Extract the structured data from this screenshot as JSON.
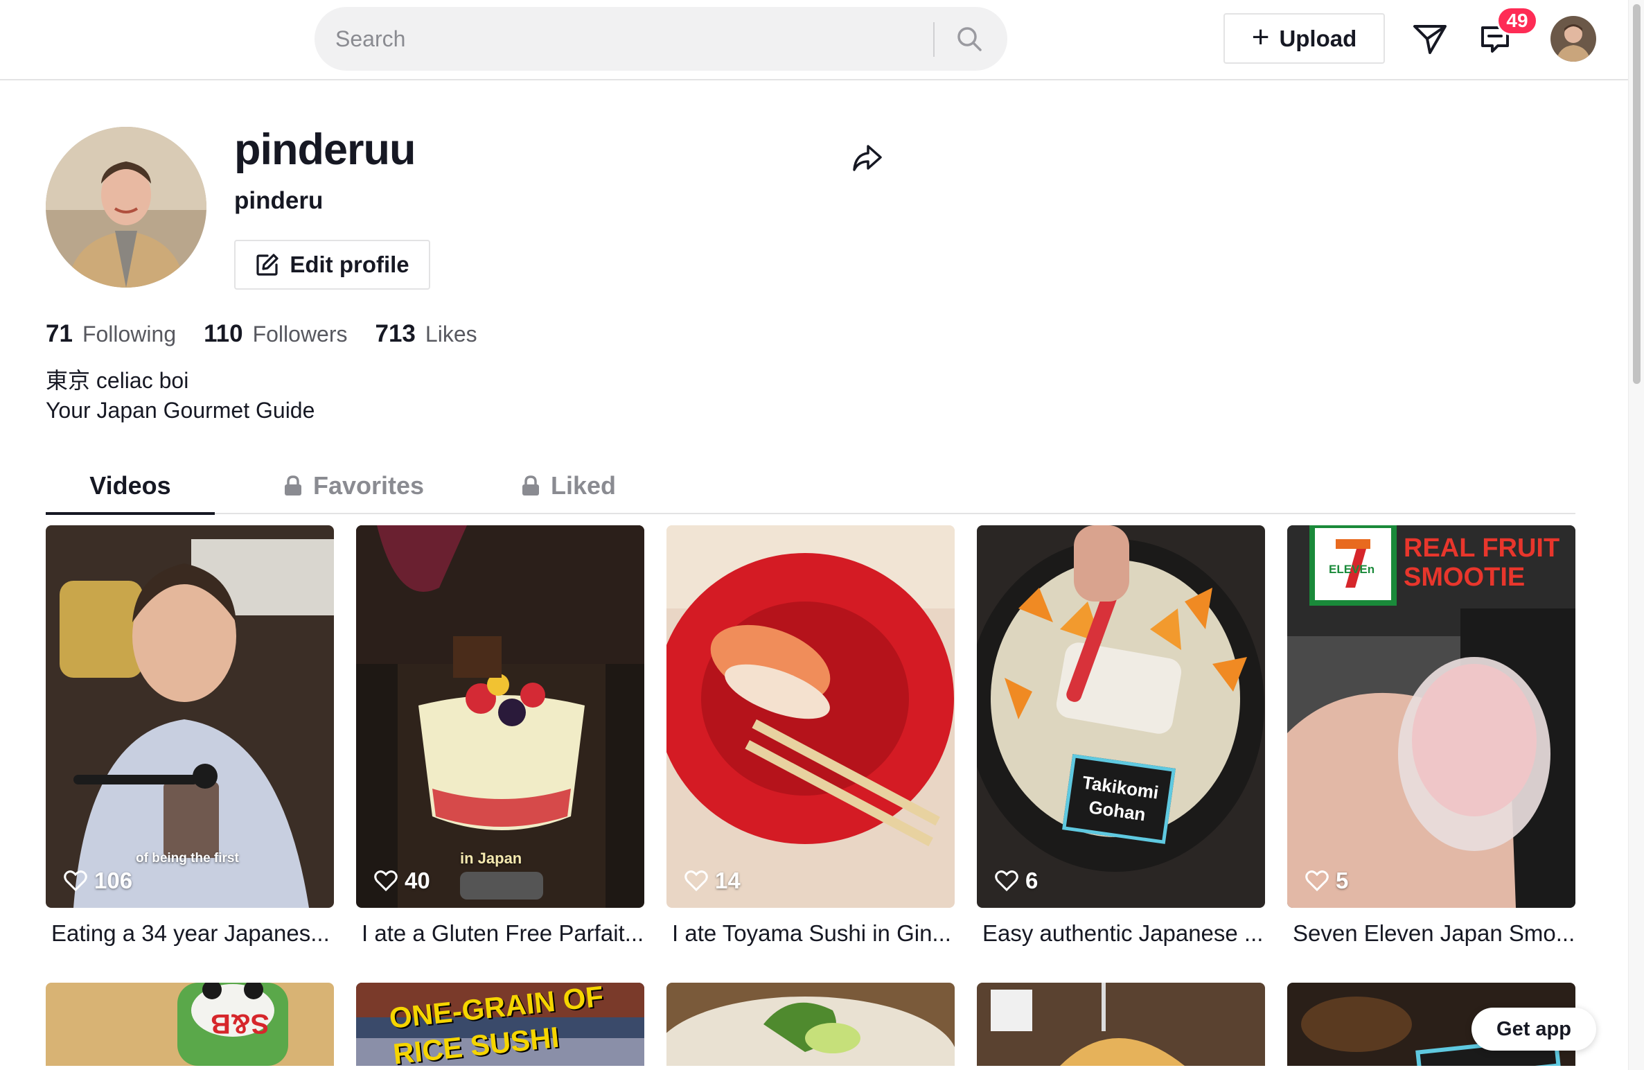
{
  "header": {
    "search_placeholder": "Search",
    "upload_label": "Upload",
    "inbox_badge": "49"
  },
  "profile": {
    "username": "pinderuu",
    "nickname": "pinderu",
    "edit_label": "Edit profile",
    "stats": {
      "following_count": "71",
      "following_label": "Following",
      "followers_count": "110",
      "followers_label": "Followers",
      "likes_count": "713",
      "likes_label": "Likes"
    },
    "bio_line1": "東京 celiac boi",
    "bio_line2": "Your Japan Gourmet Guide"
  },
  "tabs": [
    {
      "label": "Videos",
      "active": true,
      "locked": false
    },
    {
      "label": "Favorites",
      "active": false,
      "locked": true
    },
    {
      "label": "Liked",
      "active": false,
      "locked": true
    }
  ],
  "videos": [
    {
      "likes": "106",
      "title": "Eating a 34 year Japanes...",
      "overlay": "of being the first"
    },
    {
      "likes": "40",
      "title": "I ate a Gluten Free Parfait...",
      "overlay": "in Japan"
    },
    {
      "likes": "14",
      "title": "I ate Toyama Sushi in Gin...",
      "overlay": ""
    },
    {
      "likes": "6",
      "title": "Easy authentic Japanese ...",
      "overlay": "Takikomi Gohan"
    },
    {
      "likes": "5",
      "title": "Seven Eleven Japan Smo...",
      "overlay": "REAL FRUIT SMOOTIE",
      "brand": "ELEVEn"
    }
  ],
  "row2_overlays": {
    "card2": "ONE-GRAIN OF RICE SUSHI",
    "card1": "S&B"
  },
  "get_app_label": "Get app",
  "colors": {
    "accent": "#fe2c55",
    "text": "#161823",
    "muted": "#8a8b91",
    "border": "#e3e3e4"
  }
}
